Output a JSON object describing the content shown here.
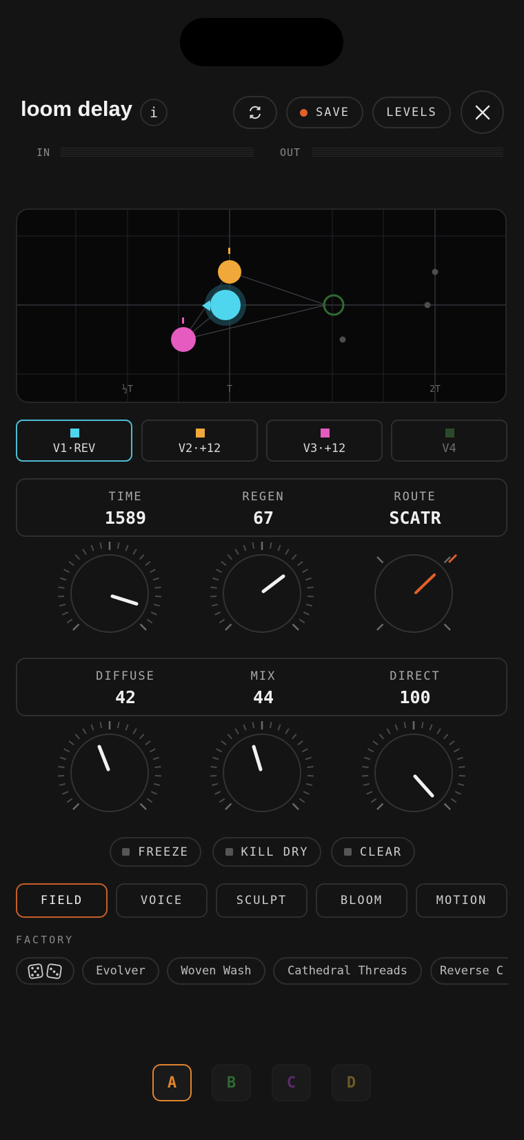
{
  "header": {
    "title": "loom delay",
    "info_label": "i",
    "save_label": "SAVE",
    "levels_label": "LEVELS"
  },
  "meters": {
    "in_label": "IN",
    "out_label": "OUT"
  },
  "field": {
    "x_ticks": [
      "½T",
      "T",
      "2T"
    ]
  },
  "voices": [
    {
      "label": "V1·REV",
      "color": "#4fd6ef",
      "active": true
    },
    {
      "label": "V2·+12",
      "color": "#f0a83a",
      "active": false
    },
    {
      "label": "V3·+12",
      "color": "#e55bbf",
      "active": false
    },
    {
      "label": "V4",
      "color": "#2b4a2b",
      "active": false
    }
  ],
  "params_top": [
    {
      "label": "TIME",
      "value": "1589"
    },
    {
      "label": "REGEN",
      "value": "67"
    },
    {
      "label": "ROUTE",
      "value": "SCATR"
    }
  ],
  "params_bottom": [
    {
      "label": "DIFFUSE",
      "value": "42"
    },
    {
      "label": "MIX",
      "value": "44"
    },
    {
      "label": "DIRECT",
      "value": "100"
    }
  ],
  "toggles": {
    "freeze": "FREEZE",
    "kill_dry": "KILL DRY",
    "clear": "CLEAR"
  },
  "tabs": [
    "FIELD",
    "VOICE",
    "SCULPT",
    "BLOOM",
    "MOTION"
  ],
  "active_tab": "FIELD",
  "presets": {
    "section_label": "FACTORY",
    "items": [
      "Evolver",
      "Woven Wash",
      "Cathedral Threads",
      "Reverse C"
    ]
  },
  "slots": [
    {
      "label": "A",
      "color": "#e0852f",
      "active": true
    },
    {
      "label": "B",
      "color": "#2f6a32",
      "active": false
    },
    {
      "label": "C",
      "color": "#5d2a6e",
      "active": false
    },
    {
      "label": "D",
      "color": "#6a5a25",
      "active": false
    }
  ],
  "colors": {
    "accent": "#e2602a",
    "background": "#141414"
  }
}
